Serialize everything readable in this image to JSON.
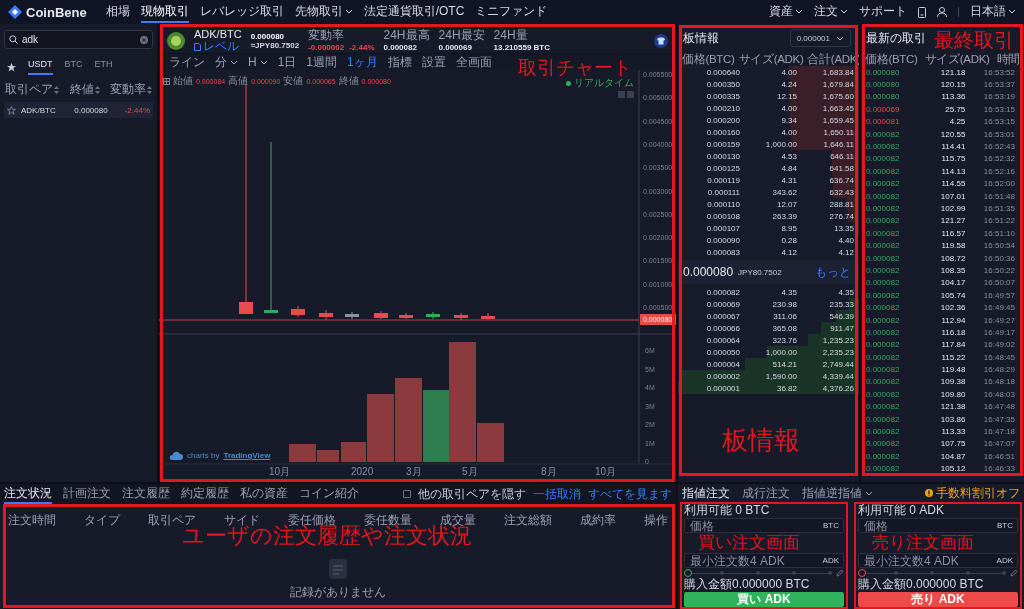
{
  "nav": {
    "logo": "CoinBene",
    "items": [
      {
        "label": "相場",
        "selected": false,
        "dropdown": false
      },
      {
        "label": "現物取引",
        "selected": true,
        "dropdown": false
      },
      {
        "label": "レバレッジ取引",
        "selected": false,
        "dropdown": false
      },
      {
        "label": "先物取引",
        "selected": false,
        "dropdown": true
      },
      {
        "label": "法定通貨取引/OTC",
        "selected": false,
        "dropdown": false
      },
      {
        "label": "ミニファンド",
        "selected": false,
        "dropdown": false
      }
    ],
    "right": [
      {
        "label": "資産",
        "dropdown": true
      },
      {
        "label": "注文",
        "dropdown": true
      },
      {
        "label": "サポート",
        "dropdown": false
      }
    ],
    "language": {
      "label": "日本語",
      "dropdown": true
    }
  },
  "market_list": {
    "search": {
      "value": "adk"
    },
    "tabs": [
      {
        "label": "USDT",
        "selected": true
      },
      {
        "label": "BTC",
        "selected": false
      },
      {
        "label": "ETH",
        "selected": false
      }
    ],
    "columns": [
      "取引ペア",
      "終値",
      "変動率"
    ],
    "rows": [
      {
        "pair": "ADK/BTC",
        "price": "0.000080",
        "change": "-2.44%",
        "negative": true,
        "selected": true,
        "favorite": false
      }
    ]
  },
  "chart": {
    "pair": "ADK/BTC",
    "level_link": "レベル",
    "price": "0.000080",
    "price_jpy": "≈JPY80.7502",
    "stats": [
      {
        "label": "変動率",
        "values": [
          "-0.000002",
          "-2.44%"
        ],
        "negative": true
      },
      {
        "label": "24H最高",
        "values": [
          "0.000082"
        ],
        "negative": false
      },
      {
        "label": "24H最安",
        "values": [
          "0.000069"
        ],
        "negative": false
      },
      {
        "label": "24H量",
        "values": [
          "13.210559 BTC"
        ],
        "negative": false
      }
    ],
    "toolbar": [
      {
        "label": "ライン",
        "selected": false,
        "dropdown": false
      },
      {
        "label": "分",
        "selected": false,
        "dropdown": true
      },
      {
        "label": "H",
        "selected": false,
        "dropdown": true
      },
      {
        "label": "1日",
        "selected": false,
        "dropdown": false
      },
      {
        "label": "1週間",
        "selected": false,
        "dropdown": false
      },
      {
        "label": "1ヶ月",
        "selected": true,
        "dropdown": false
      },
      {
        "label": "指標",
        "selected": false,
        "dropdown": false
      },
      {
        "label": "設置",
        "selected": false,
        "dropdown": false
      },
      {
        "label": "全画面",
        "selected": false,
        "dropdown": false
      }
    ],
    "ohlc": [
      {
        "label": "始値",
        "value": "0.000084"
      },
      {
        "label": "高値",
        "value": "0.000090"
      },
      {
        "label": "安値",
        "value": "0.000065"
      },
      {
        "label": "終値",
        "value": "0.000080"
      }
    ],
    "realtime": "リアルタイム",
    "price_axis": [
      "0.005500",
      "0.005000",
      "0.004500",
      "0.004000",
      "0.003500",
      "0.003000",
      "0.002500",
      "0.002000",
      "0.001500",
      "0.001000",
      "0.000500"
    ],
    "last_price_tag": "0.000080",
    "volume_axis": [
      "6M",
      "5M",
      "4M",
      "3M",
      "2M",
      "1M",
      "0"
    ],
    "time_axis": [
      "10月",
      "2020",
      "3月",
      "5月",
      "8月",
      "10月"
    ],
    "attribution": {
      "text": "charts by",
      "brand": "TradingView"
    },
    "annotation": "取引チャート"
  },
  "orderbook": {
    "title": "板情報",
    "precision": "0.000001",
    "columns": [
      "価格(BTC)",
      "サイズ(ADK)",
      "合計(ADK)"
    ],
    "asks": [
      {
        "price": "0.000640",
        "size": "4.00",
        "total": "1,683.84",
        "level": 0.385
      },
      {
        "price": "0.000350",
        "size": "4.24",
        "total": "1,679.84",
        "level": 0.384
      },
      {
        "price": "0.000335",
        "size": "12.15",
        "total": "1,675.60",
        "level": 0.383
      },
      {
        "price": "0.000210",
        "size": "4.00",
        "total": "1,663.45",
        "level": 0.38
      },
      {
        "price": "0.000200",
        "size": "9.34",
        "total": "1,659.45",
        "level": 0.379
      },
      {
        "price": "0.000160",
        "size": "4.00",
        "total": "1,650.11",
        "level": 0.377
      },
      {
        "price": "0.000159",
        "size": "1,000.00",
        "total": "1,646.11",
        "level": 0.376
      },
      {
        "price": "0.000130",
        "size": "4.53",
        "total": "646.11",
        "level": 0.148
      },
      {
        "price": "0.000125",
        "size": "4.84",
        "total": "641.58",
        "level": 0.147
      },
      {
        "price": "0.000119",
        "size": "4.31",
        "total": "636.74",
        "level": 0.146
      },
      {
        "price": "0.000111",
        "size": "343.62",
        "total": "632.43",
        "level": 0.145
      },
      {
        "price": "0.000110",
        "size": "12.07",
        "total": "288.81",
        "level": 0.066
      },
      {
        "price": "0.000108",
        "size": "263.39",
        "total": "276.74",
        "level": 0.063
      },
      {
        "price": "0.000107",
        "size": "8.95",
        "total": "13.35",
        "level": 0.003
      },
      {
        "price": "0.000090",
        "size": "0.28",
        "total": "4.40",
        "level": 0.001
      },
      {
        "price": "0.000083",
        "size": "4.12",
        "total": "4.12",
        "level": 0.001
      }
    ],
    "last": {
      "price": "0.000080",
      "jpy": "JPY80.7502",
      "more": "もっと"
    },
    "bids": [
      {
        "price": "0.000082",
        "size": "4.35",
        "total": "4.35",
        "level": 0.001
      },
      {
        "price": "0.000069",
        "size": "230.98",
        "total": "235.33",
        "level": 0.054
      },
      {
        "price": "0.000067",
        "size": "311.06",
        "total": "546.39",
        "level": 0.125
      },
      {
        "price": "0.000066",
        "size": "365.08",
        "total": "911.47",
        "level": 0.208
      },
      {
        "price": "0.000064",
        "size": "323.76",
        "total": "1,235.23",
        "level": 0.282
      },
      {
        "price": "0.000050",
        "size": "1,000.00",
        "total": "2,235.23",
        "level": 0.511
      },
      {
        "price": "0.000004",
        "size": "514.21",
        "total": "2,749.44",
        "level": 0.628
      },
      {
        "price": "0.000002",
        "size": "1,590.00",
        "total": "4,339.44",
        "level": 0.992
      },
      {
        "price": "0.000001",
        "size": "36.82",
        "total": "4,376.26",
        "level": 1
      }
    ],
    "annotation": "板情報"
  },
  "trades": {
    "title": "最新の取引",
    "columns": [
      "価格(BTC)",
      "サイズ(ADK)",
      "時間"
    ],
    "rows": [
      {
        "price": "0.000080",
        "size": "121.18",
        "time": "16:53:52",
        "sell": false
      },
      {
        "price": "0.000080",
        "size": "120.15",
        "time": "16:53:37",
        "sell": false
      },
      {
        "price": "0.000080",
        "size": "113.36",
        "time": "16:53:19",
        "sell": false
      },
      {
        "price": "0.000069",
        "size": "25.75",
        "time": "16:53:15",
        "sell": true
      },
      {
        "price": "0.000081",
        "size": "4.25",
        "time": "16:53:15",
        "sell": true
      },
      {
        "price": "0.000082",
        "size": "120.55",
        "time": "16:53:01",
        "sell": false
      },
      {
        "price": "0.000082",
        "size": "114.41",
        "time": "16:52:43",
        "sell": false
      },
      {
        "price": "0.000082",
        "size": "115.75",
        "time": "16:52:32",
        "sell": false
      },
      {
        "price": "0.000082",
        "size": "114.13",
        "time": "16:52:16",
        "sell": false
      },
      {
        "price": "0.000082",
        "size": "114.55",
        "time": "16:52:00",
        "sell": false
      },
      {
        "price": "0.000082",
        "size": "107.01",
        "time": "16:51:48",
        "sell": false
      },
      {
        "price": "0.000082",
        "size": "102.99",
        "time": "16:51:35",
        "sell": false
      },
      {
        "price": "0.000082",
        "size": "121.27",
        "time": "16:51:22",
        "sell": false
      },
      {
        "price": "0.000082",
        "size": "116.57",
        "time": "16:51:10",
        "sell": false
      },
      {
        "price": "0.000082",
        "size": "119.58",
        "time": "16:50:54",
        "sell": false
      },
      {
        "price": "0.000082",
        "size": "108.72",
        "time": "16:50:36",
        "sell": false
      },
      {
        "price": "0.000082",
        "size": "108.35",
        "time": "16:50:22",
        "sell": false
      },
      {
        "price": "0.000082",
        "size": "104.17",
        "time": "16:50:07",
        "sell": false
      },
      {
        "price": "0.000082",
        "size": "105.74",
        "time": "16:49:57",
        "sell": false
      },
      {
        "price": "0.000082",
        "size": "102.36",
        "time": "16:49:45",
        "sell": false
      },
      {
        "price": "0.000082",
        "size": "112.94",
        "time": "16:49:27",
        "sell": false
      },
      {
        "price": "0.000082",
        "size": "116.18",
        "time": "16:49:17",
        "sell": false
      },
      {
        "price": "0.000082",
        "size": "117.84",
        "time": "16:49:02",
        "sell": false
      },
      {
        "price": "0.000082",
        "size": "115.22",
        "time": "16:48:45",
        "sell": false
      },
      {
        "price": "0.000082",
        "size": "119.48",
        "time": "16:48:29",
        "sell": false
      },
      {
        "price": "0.000082",
        "size": "109.38",
        "time": "16:48:18",
        "sell": false
      },
      {
        "price": "0.000082",
        "size": "109.80",
        "time": "16:48:03",
        "sell": false
      },
      {
        "price": "0.000082",
        "size": "121.38",
        "time": "16:47:48",
        "sell": false
      },
      {
        "price": "0.000082",
        "size": "103.86",
        "time": "16:47:35",
        "sell": false
      },
      {
        "price": "0.000082",
        "size": "113.33",
        "time": "16:47:18",
        "sell": false
      },
      {
        "price": "0.000082",
        "size": "107.75",
        "time": "16:47:07",
        "sell": false
      },
      {
        "price": "0.000082",
        "size": "104.87",
        "time": "16:46:51",
        "sell": false
      },
      {
        "price": "0.000082",
        "size": "105.12",
        "time": "16:46:33",
        "sell": false
      }
    ],
    "annotation": "最終取引"
  },
  "orders": {
    "tabs": [
      {
        "label": "注文状況",
        "selected": true
      },
      {
        "label": "計画注文",
        "selected": false
      },
      {
        "label": "注文履歴",
        "selected": false
      },
      {
        "label": "約定履歴",
        "selected": false
      },
      {
        "label": "私の資産",
        "selected": false
      },
      {
        "label": "コイン紹介",
        "selected": false
      }
    ],
    "hide_other_pairs": {
      "label": "他の取引ペアを隠す",
      "checked": false
    },
    "cancel_all": "一括取消",
    "view_all": "すべてを見ます",
    "columns": [
      "注文時間",
      "タイプ",
      "取引ペア",
      "サイド",
      "委任価格",
      "委任数量",
      "成交量",
      "注文総額",
      "成約率",
      "操作"
    ],
    "empty": "記録がありません",
    "annotation": "ユーザの注文履歴や注文状況"
  },
  "trade_form": {
    "tabs": [
      {
        "label": "指値注文",
        "selected": true,
        "dropdown": false
      },
      {
        "label": "成行注文",
        "selected": false,
        "dropdown": false
      },
      {
        "label": "指値逆指値",
        "selected": false,
        "dropdown": true
      }
    ],
    "fee_discount": "手数料割引オフ",
    "forms": [
      {
        "kind": "buy",
        "available": "利用可能 0 BTC",
        "price_placeholder": "価格",
        "price_unit": "BTC",
        "amount_placeholder": "最小注文数4 ADK",
        "amount_unit": "ADK",
        "level": 0,
        "total": "購入金額0.000000 BTC",
        "button": "買い ADK",
        "annotation": "買い注文画面"
      },
      {
        "kind": "sell",
        "available": "利用可能 0 ADK",
        "price_placeholder": "価格",
        "price_unit": "BTC",
        "amount_placeholder": "最小注文数4 ADK",
        "amount_unit": "ADK",
        "level": 0,
        "total": "購入金額0.000000 BTC",
        "button": "売り ADK",
        "annotation": "売り注文画面"
      }
    ]
  }
}
